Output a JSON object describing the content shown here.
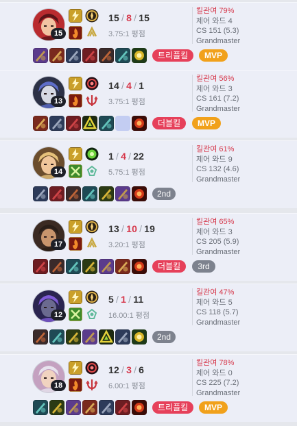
{
  "cards": [
    {
      "level": "15",
      "kills": "15",
      "deaths": "8",
      "assists": "15",
      "kda_ratio": "3.75:1 평점",
      "kill_participation": "킬관여 79%",
      "control_wards": "제어 와드 4",
      "cs": "CS 151 (5.3)",
      "tier": "Grandmaster",
      "multikill": "트리플킬",
      "achievement": "MVP",
      "rank": "",
      "champion_icon": "champion-portrait-red-hair",
      "spells": [
        "flash-spell-icon",
        "ignite-spell-icon"
      ],
      "runes": [
        "conqueror-rune-icon",
        "precision-tree-icon"
      ],
      "items": [
        "blade-item-icon",
        "bow-item-icon",
        "cleaver-item-icon",
        "gauntlet-item-icon",
        "claw-item-icon",
        "armor-item-icon",
        "trinket-item-icon"
      ]
    },
    {
      "level": "13",
      "kills": "14",
      "deaths": "4",
      "assists": "1",
      "kda_ratio": "3.75:1 평점",
      "kill_participation": "킬관여 56%",
      "control_wards": "제어 와드 3",
      "cs": "CS 161 (7.2)",
      "tier": "Grandmaster",
      "multikill": "더블킬",
      "achievement": "MVP",
      "rank": "",
      "champion_icon": "champion-portrait-dark-mask",
      "spells": [
        "flash-spell-icon",
        "ignite-spell-icon"
      ],
      "runes": [
        "electrocute-rune-icon",
        "domination-tree-icon"
      ],
      "items": [
        "sword-item-icon",
        "dagger-item-icon",
        "shield-item-icon",
        "triangle-item-icon",
        "spear-item-icon",
        "empty-slot",
        "oracle-trinket-icon"
      ]
    },
    {
      "level": "14",
      "kills": "1",
      "deaths": "4",
      "assists": "22",
      "kda_ratio": "5.75:1 평점",
      "kill_participation": "킬관여 61%",
      "control_wards": "제어 와드 9",
      "cs": "CS 132 (4.6)",
      "tier": "Grandmaster",
      "multikill": "",
      "achievement": "",
      "rank": "2nd",
      "champion_icon": "champion-portrait-blonde",
      "spells": [
        "flash-spell-icon",
        "exhaust-spell-icon"
      ],
      "runes": [
        "aftershock-rune-icon",
        "resolve-tree-icon"
      ],
      "items": [
        "boots-item-icon",
        "tome-item-icon",
        "chest-item-icon",
        "relic-item-icon",
        "gem-item-icon",
        "plate-item-icon",
        "oracle-trinket-icon"
      ]
    },
    {
      "level": "17",
      "kills": "13",
      "deaths": "10",
      "assists": "19",
      "kda_ratio": "3.20:1 평점",
      "kill_participation": "킬관여 65%",
      "control_wards": "제어 와드 3",
      "cs": "CS 205 (5.9)",
      "tier": "Grandmaster",
      "multikill": "더블킬",
      "achievement": "",
      "rank": "3rd",
      "champion_icon": "champion-portrait-bearded",
      "spells": [
        "flash-spell-icon",
        "ignite-spell-icon"
      ],
      "runes": [
        "lethal-tempo-rune-icon",
        "precision-tree-icon"
      ],
      "items": [
        "cloak-item-icon",
        "bow-item-icon",
        "blade-item-icon",
        "cannon-item-icon",
        "hammer-item-icon",
        "claw-item-icon",
        "oracle-trinket-icon"
      ]
    },
    {
      "level": "12",
      "kills": "5",
      "deaths": "1",
      "assists": "11",
      "kda_ratio": "16.00:1 평점",
      "kill_participation": "킬관여 47%",
      "control_wards": "제어 와드 5",
      "cs": "CS 118 (5.7)",
      "tier": "Grandmaster",
      "multikill": "",
      "achievement": "",
      "rank": "2nd",
      "champion_icon": "champion-portrait-purple-armor",
      "spells": [
        "flash-spell-icon",
        "exhaust-spell-icon"
      ],
      "runes": [
        "lethal-tempo-rune-icon",
        "resolve-tree-icon"
      ],
      "items": [
        "wand-item-icon",
        "chalice-item-icon",
        "chest-item-icon",
        "hammer-item-icon",
        "triangle-item-icon",
        "helm-item-icon",
        "trinket-item-icon"
      ]
    },
    {
      "level": "18",
      "kills": "12",
      "deaths": "3",
      "assists": "6",
      "kda_ratio": "6.00:1 평점",
      "kill_participation": "킬관여 78%",
      "control_wards": "제어 와드 0",
      "cs": "CS 225 (7.2)",
      "tier": "Grandmaster",
      "multikill": "트리플킬",
      "achievement": "MVP",
      "rank": "",
      "champion_icon": "champion-portrait-white-hair",
      "spells": [
        "flash-spell-icon",
        "ignite-spell-icon"
      ],
      "runes": [
        "electrocute-rune-icon",
        "domination-tree-icon"
      ],
      "items": [
        "staff-item-icon",
        "bow-item-icon",
        "blade-item-icon",
        "cleaver-item-icon",
        "gem-item-icon",
        "orb-item-icon",
        "oracle-trinket-icon"
      ]
    }
  ],
  "colors": {
    "card_bg": "#eceef7",
    "death_red": "#d6384b",
    "multikill_red": "#e6405a",
    "mvp_orange": "#f1a11b",
    "rank_gray": "#7d828e"
  }
}
